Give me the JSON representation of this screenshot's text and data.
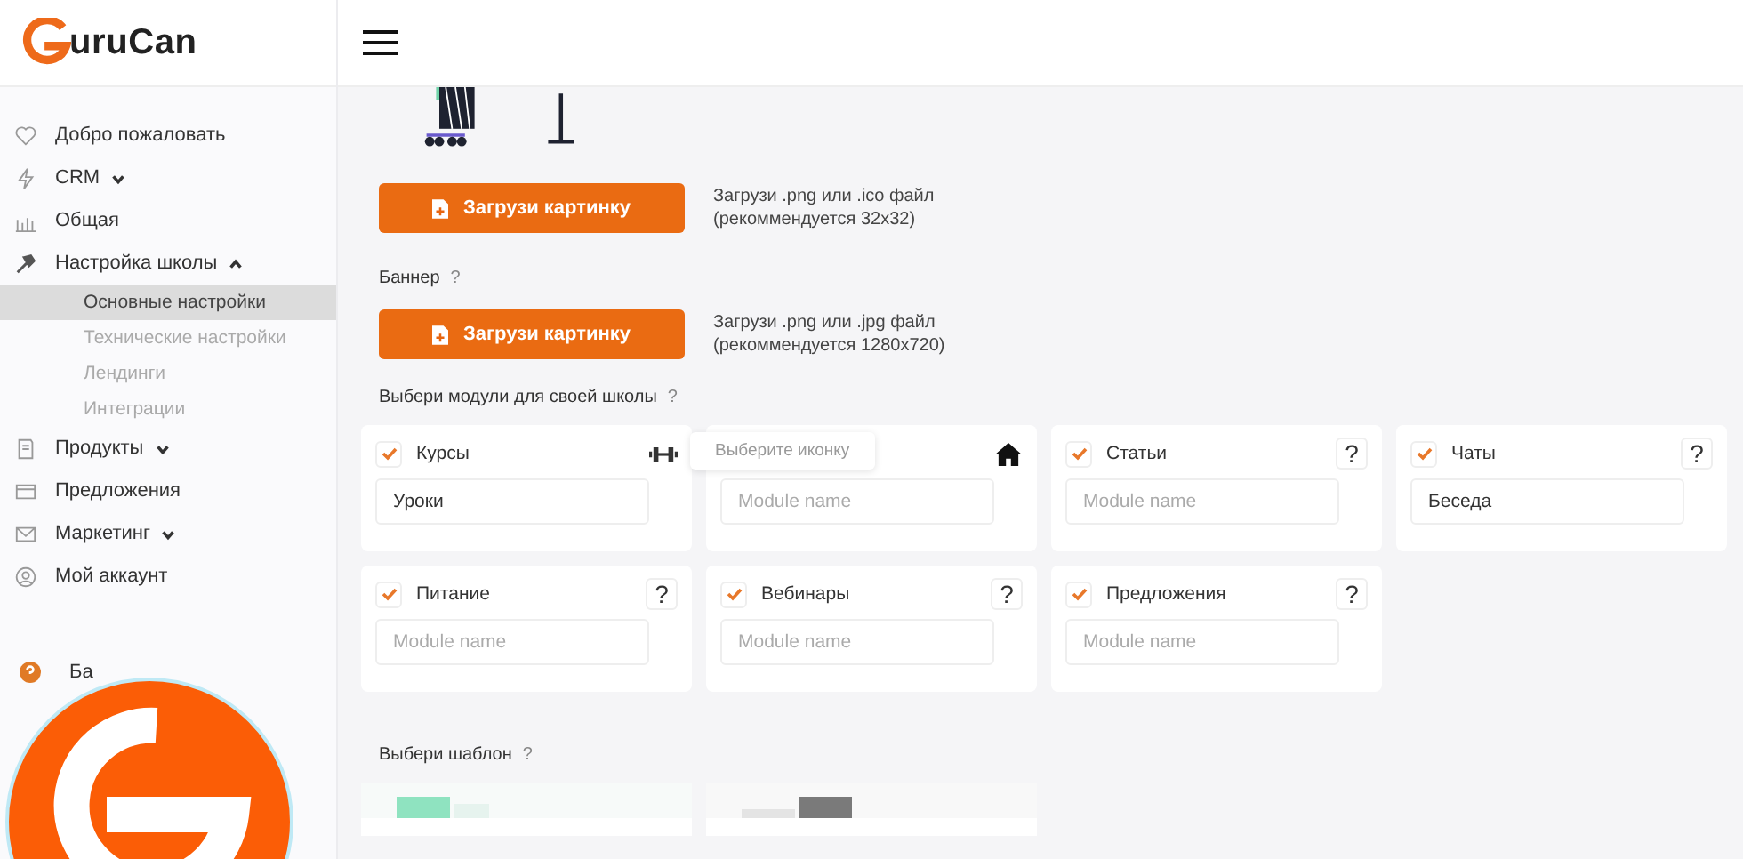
{
  "logo": {
    "text": "uruCan"
  },
  "sidebar": {
    "items": [
      {
        "label": "Добро пожаловать"
      },
      {
        "label": "CRM",
        "expanded": false
      },
      {
        "label": "Общая"
      },
      {
        "label": "Настройка школы",
        "expanded": true,
        "children": [
          {
            "label": "Основные настройки",
            "selected": true
          },
          {
            "label": "Технические настройки",
            "selected": false
          },
          {
            "label": "Лендинги",
            "selected": false
          },
          {
            "label": "Интеграции",
            "selected": false
          }
        ]
      },
      {
        "label": "Продукты",
        "expanded": false
      },
      {
        "label": "Предложения"
      },
      {
        "label": "Маркетинг",
        "expanded": false
      },
      {
        "label": "Мой аккаунт"
      }
    ],
    "bottom_item": {
      "label": "Ба"
    }
  },
  "uploads": [
    {
      "button": "Загрузи картинку",
      "hint_1": "Загрузи .png или .ico файл",
      "hint_2": "(рекоммендуется 32x32)"
    },
    {
      "label": "Баннер",
      "help": "?",
      "button": "Загрузи картинку",
      "hint_1": "Загрузи .png или .jpg файл",
      "hint_2": "(рекоммендуется 1280x720)"
    }
  ],
  "modules_title": {
    "text": "Выбери модули для своей школы",
    "help": "?"
  },
  "modules": [
    {
      "title": "Курсы",
      "checked": true,
      "value": "Уроки"
    },
    {
      "placeholder": "Module name"
    },
    {
      "title": "Статьи",
      "checked": true,
      "help": "?",
      "placeholder": "Module name"
    },
    {
      "title": "Чаты",
      "checked": true,
      "help": "?",
      "value": "Беседа"
    },
    {
      "title": "Питание",
      "checked": true,
      "help": "?",
      "placeholder": "Module name"
    },
    {
      "title": "Вебинары",
      "checked": true,
      "help": "?",
      "placeholder": "Module name"
    },
    {
      "title": "Предложения",
      "checked": true,
      "help": "?",
      "placeholder": "Module name"
    }
  ],
  "tooltip": {
    "text": "Выберите иконку"
  },
  "template_title": {
    "text": "Выбери шаблон",
    "help": "?"
  }
}
